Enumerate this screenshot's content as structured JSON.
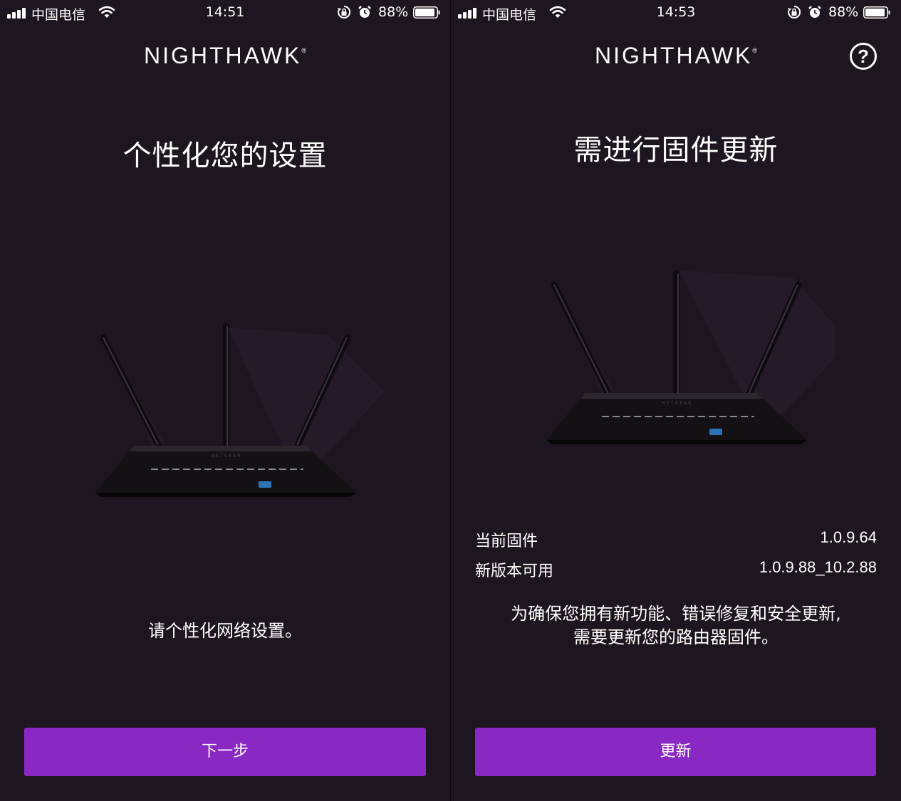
{
  "left_screen": {
    "status_bar": {
      "carrier": "中国电信",
      "time": "14:51",
      "battery": "88%"
    },
    "logo": "NIGHTHAWK",
    "logo_mark": "®",
    "title": "个性化您的设置",
    "message": "请个性化网络设置。",
    "button_label": "下一步"
  },
  "right_screen": {
    "status_bar": {
      "carrier": "中国电信",
      "time": "14:53",
      "battery": "88%"
    },
    "logo": "NIGHTHAWK",
    "logo_mark": "®",
    "help_icon_label": "?",
    "title": "需进行固件更新",
    "current_firmware_label": "当前固件",
    "current_firmware_value": "1.0.9.64",
    "new_version_label": "新版本可用",
    "new_version_value": "1.0.9.88_10.2.88",
    "message_line1": "为确保您拥有新功能、错误修复和安全更新,",
    "message_line2": "需要更新您的路由器固件。",
    "button_label": "更新"
  },
  "colors": {
    "background": "#1d1520",
    "button": "#8a28c4",
    "text": "#ffffff"
  },
  "icons": [
    "signal-icon",
    "wifi-icon",
    "orientation-lock-icon",
    "alarm-icon",
    "battery-icon",
    "help-icon",
    "router-image"
  ]
}
